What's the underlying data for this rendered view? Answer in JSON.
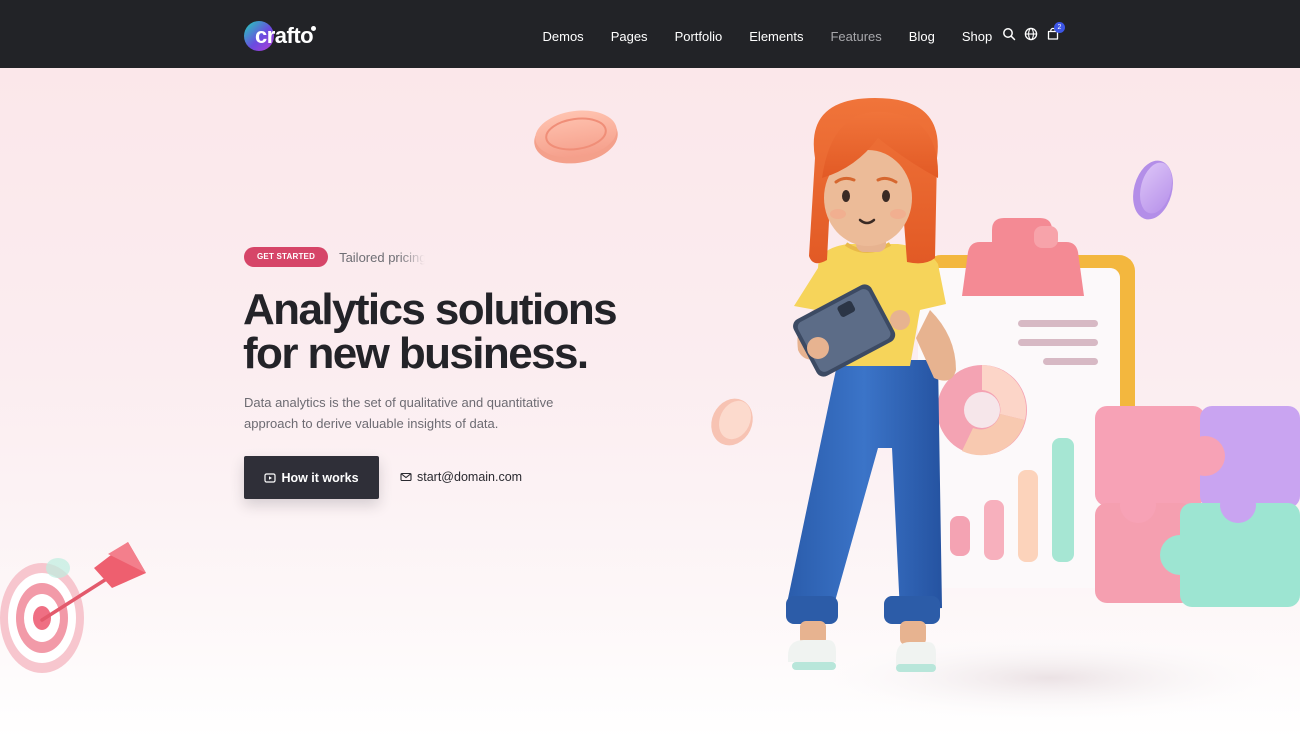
{
  "brand": {
    "name": "crafto"
  },
  "nav": {
    "items": [
      {
        "label": "Demos",
        "dim": false
      },
      {
        "label": "Pages",
        "dim": false
      },
      {
        "label": "Portfolio",
        "dim": false
      },
      {
        "label": "Elements",
        "dim": false
      },
      {
        "label": "Features",
        "dim": true
      },
      {
        "label": "Blog",
        "dim": false
      },
      {
        "label": "Shop",
        "dim": false
      }
    ],
    "icons": [
      "search-icon",
      "globe-icon",
      "cart-icon"
    ],
    "cart_count": "2"
  },
  "hero": {
    "tag_label": "GET STARTED",
    "tag_text": "Tailored pricing",
    "headline_line1": "Analytics solutions",
    "headline_line2_prefix": "for new ",
    "headline_line2_highlight": "business.",
    "description": "Data analytics is the set of qualitative and quantitative approach to derive valuable insights of data.",
    "primary_button": "How it works",
    "email": "start@domain.com"
  },
  "colors": {
    "navbar": "#222327",
    "accent_pink": "#d64568",
    "button_dark": "#2f2f38",
    "cart_badge": "#3c55e6"
  }
}
